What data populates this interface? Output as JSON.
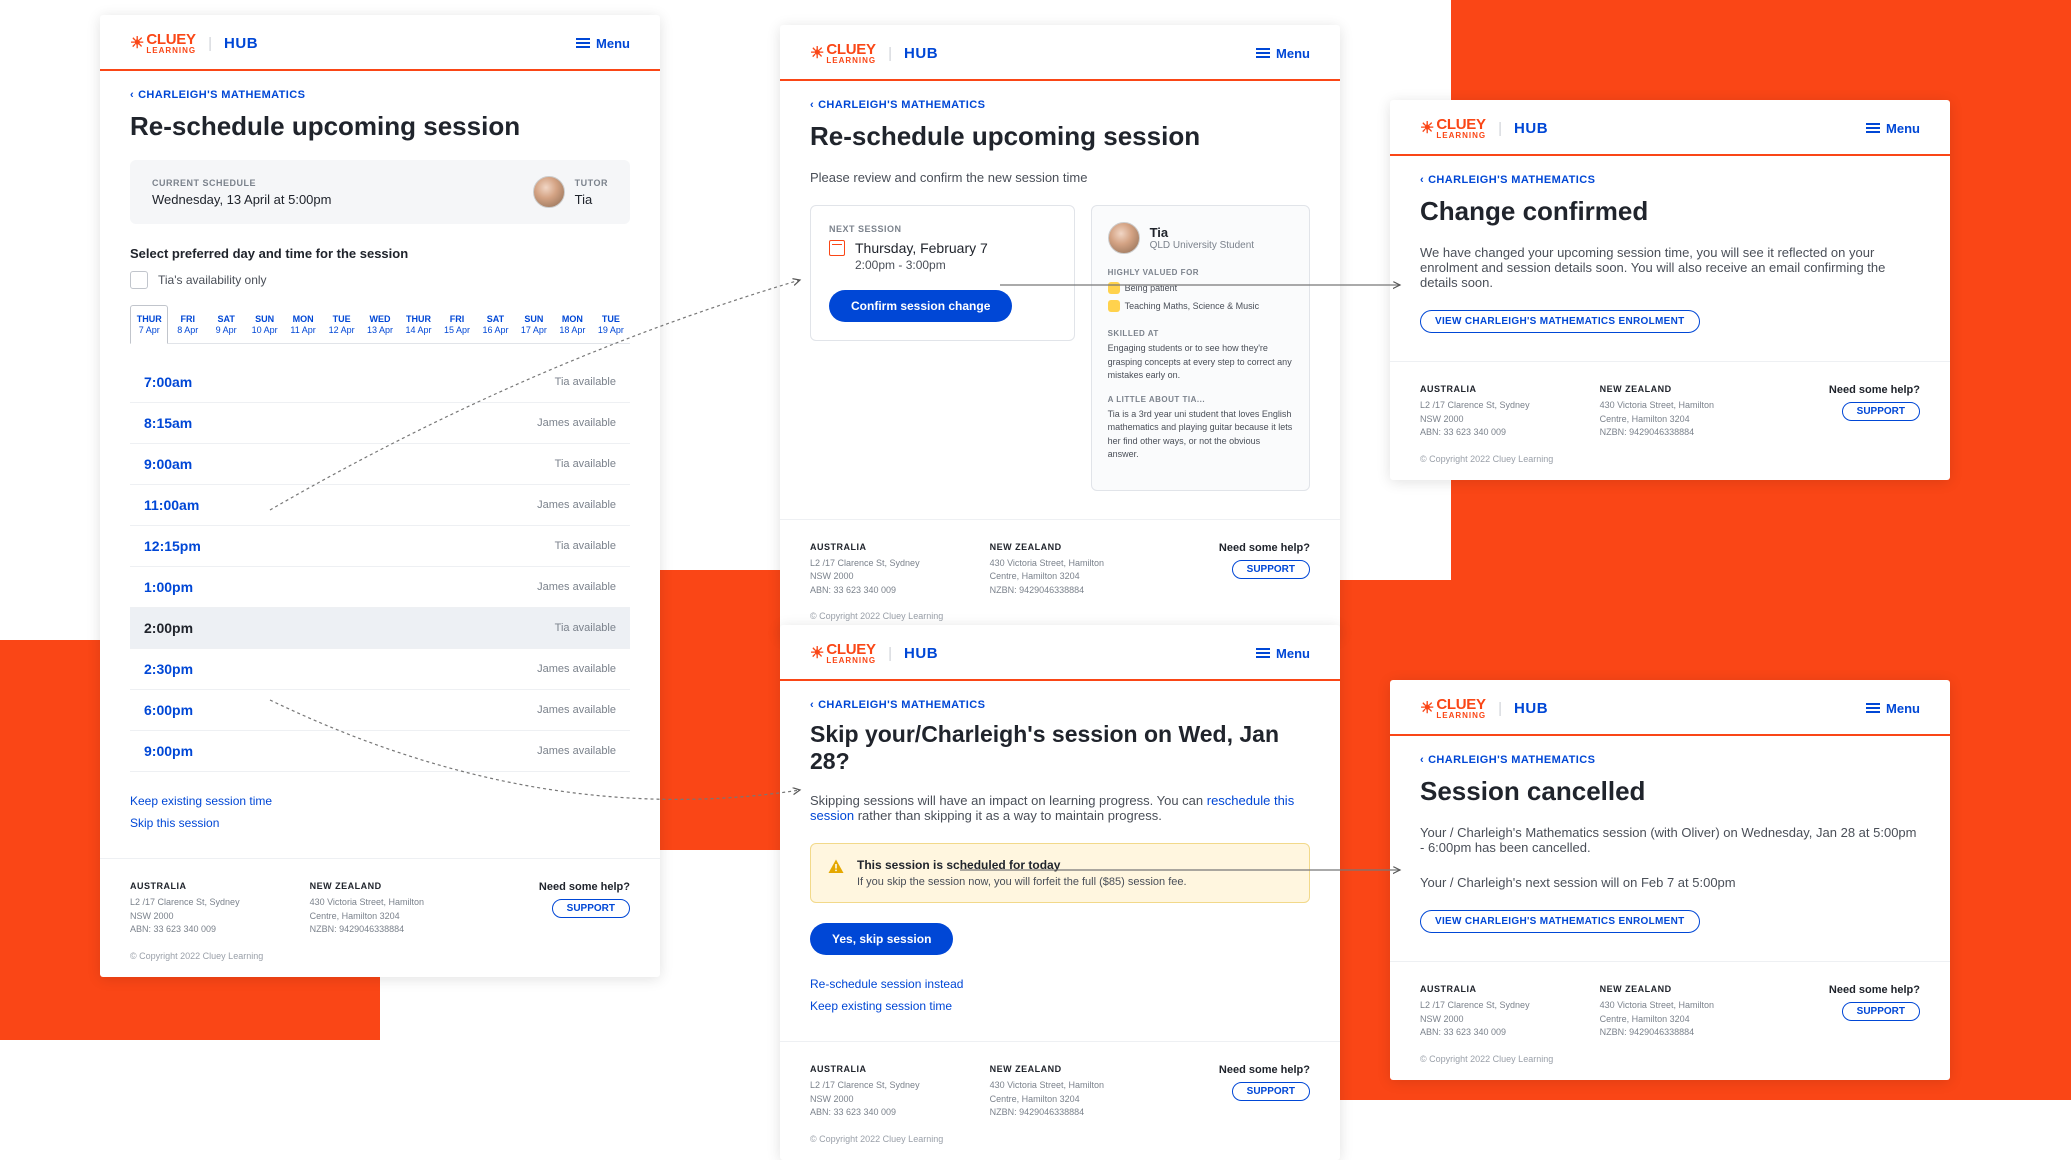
{
  "brand": {
    "name": "CLUEY",
    "sub": "LEARNING",
    "hub": "HUB",
    "menu": "Menu"
  },
  "breadcrumb": "CHARLEIGH'S MATHEMATICS",
  "footer": {
    "au": {
      "h": "AUSTRALIA",
      "l1": "L2 /17 Clarence St, Sydney",
      "l2": "NSW 2000",
      "l3": "ABN: 33 623 340 009"
    },
    "nz": {
      "h": "NEW ZEALAND",
      "l1": "430 Victoria Street, Hamilton",
      "l2": "Centre, Hamilton 3204",
      "l3": "NZBN: 9429046338884"
    },
    "help": "Need some help?",
    "support": "SUPPORT",
    "copyright": "© Copyright 2022 Cluey Learning"
  },
  "p1": {
    "title": "Re-schedule upcoming session",
    "currentLabel": "CURRENT SCHEDULE",
    "currentVal": "Wednesday, 13 April at 5:00pm",
    "tutorLabel": "TUTOR",
    "tutorName": "Tia",
    "selectHead": "Select preferred day and time for the session",
    "chkLabel": "Tia's availability only",
    "dates": [
      {
        "dow": "THUR",
        "dt": "7 Apr"
      },
      {
        "dow": "FRI",
        "dt": "8 Apr"
      },
      {
        "dow": "SAT",
        "dt": "9 Apr"
      },
      {
        "dow": "SUN",
        "dt": "10 Apr"
      },
      {
        "dow": "MON",
        "dt": "11 Apr"
      },
      {
        "dow": "TUE",
        "dt": "12 Apr"
      },
      {
        "dow": "WED",
        "dt": "13 Apr"
      },
      {
        "dow": "THUR",
        "dt": "14 Apr"
      },
      {
        "dow": "FRI",
        "dt": "15 Apr"
      },
      {
        "dow": "SAT",
        "dt": "16 Apr"
      },
      {
        "dow": "SUN",
        "dt": "17 Apr"
      },
      {
        "dow": "MON",
        "dt": "18 Apr"
      },
      {
        "dow": "TUE",
        "dt": "19 Apr"
      }
    ],
    "slots": [
      {
        "time": "7:00am",
        "avail": "Tia available"
      },
      {
        "time": "8:15am",
        "avail": "James available"
      },
      {
        "time": "9:00am",
        "avail": "Tia available"
      },
      {
        "time": "11:00am",
        "avail": "James available"
      },
      {
        "time": "12:15pm",
        "avail": "Tia available"
      },
      {
        "time": "1:00pm",
        "avail": "James available"
      },
      {
        "time": "2:00pm",
        "avail": "Tia available"
      },
      {
        "time": "2:30pm",
        "avail": "James available"
      },
      {
        "time": "6:00pm",
        "avail": "James available"
      },
      {
        "time": "9:00pm",
        "avail": "James available"
      }
    ],
    "keep": "Keep existing session time",
    "skip": "Skip this session"
  },
  "p2": {
    "title": "Re-schedule upcoming session",
    "sub": "Please review and confirm the new session time",
    "nextLabel": "NEXT SESSION",
    "nextDay": "Thursday, February 7",
    "nextTime": "2:00pm - 3:00pm",
    "confirmBtn": "Confirm session change",
    "tutorName": "Tia",
    "tutorMeta": "QLD University Student",
    "valuedH": "HIGHLY VALUED FOR",
    "valued1": "Being patient",
    "valued2": "Teaching Maths, Science & Music",
    "skilledH": "SKILLED AT",
    "skilled": "Engaging students or to see how they're grasping concepts at every step to correct any mistakes early on.",
    "aboutH": "A LITTLE ABOUT TIA...",
    "about": "Tia is a 3rd year uni student that loves English mathematics and playing guitar because it lets her find other ways, or not the obvious answer."
  },
  "p3": {
    "title": "Change confirmed",
    "body": "We have changed your upcoming session time, you will see it reflected on your enrolment and session details soon. You will also receive an email confirming the details soon.",
    "btn": "VIEW CHARLEIGH'S MATHEMATICS ENROLMENT"
  },
  "p4": {
    "title": "Skip your/Charleigh's session on Wed, Jan 28?",
    "sub1": "Skipping sessions will have an impact on learning progress. You can ",
    "subLink": "reschedule this session",
    "sub2": " rather than skipping it as a way to maintain progress.",
    "warnT": "This session is scheduled for today",
    "warnD": "If you skip the session now, you will forfeit the full ($85) session fee.",
    "yesBtn": "Yes, skip session",
    "reschedLink": "Re-schedule session instead",
    "keepLink": "Keep existing session time"
  },
  "p5": {
    "title": "Session cancelled",
    "l1": "Your / Charleigh's Mathematics session (with Oliver) on Wednesday, Jan 28 at 5:00pm - 6:00pm has been cancelled.",
    "l2": "Your / Charleigh's next session will on Feb 7 at 5:00pm",
    "btn": "VIEW CHARLEIGH'S MATHEMATICS ENROLMENT"
  }
}
